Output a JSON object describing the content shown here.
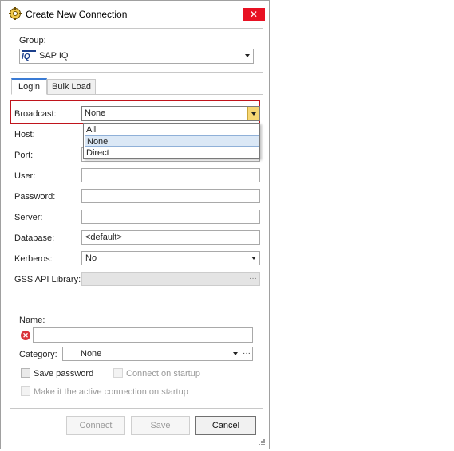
{
  "window": {
    "title": "Create New Connection",
    "close_glyph": "✕",
    "app_icon": "sapiq-gear-icon"
  },
  "group": {
    "label": "Group:",
    "value": "SAP IQ",
    "icon_text": "IQ"
  },
  "tabs": [
    {
      "label": "Login",
      "active": true
    },
    {
      "label": "Bulk Load",
      "active": false
    }
  ],
  "login": {
    "broadcast": {
      "label": "Broadcast:",
      "value": "None",
      "options": [
        "All",
        "None",
        "Direct"
      ],
      "selected_index": 1
    },
    "host": {
      "label": "Host:",
      "value": ""
    },
    "port": {
      "label": "Port:",
      "value": ""
    },
    "user": {
      "label": "User:",
      "value": ""
    },
    "password": {
      "label": "Password:",
      "value": ""
    },
    "server": {
      "label": "Server:",
      "value": ""
    },
    "database": {
      "label": "Database:",
      "value": "<default>"
    },
    "kerberos": {
      "label": "Kerberos:",
      "value": "No"
    },
    "gss": {
      "label": "GSS API Library:",
      "value": "",
      "ellipsis": "···"
    }
  },
  "connection": {
    "name_label": "Name:",
    "name_value": "",
    "category_label": "Category:",
    "category_value": "None",
    "category_ellipsis": "···",
    "save_password_label": "Save password",
    "connect_on_startup_label": "Connect on startup",
    "make_active_label": "Make it the active connection on startup"
  },
  "buttons": {
    "connect": "Connect",
    "save": "Save",
    "cancel": "Cancel"
  },
  "colors": {
    "close_red": "#e81123",
    "highlight_red": "#c0141c",
    "dropdown_yellow": "#f7d774",
    "selection_blue": "#dbe8f6",
    "tab_accent": "#3a7bd5"
  }
}
